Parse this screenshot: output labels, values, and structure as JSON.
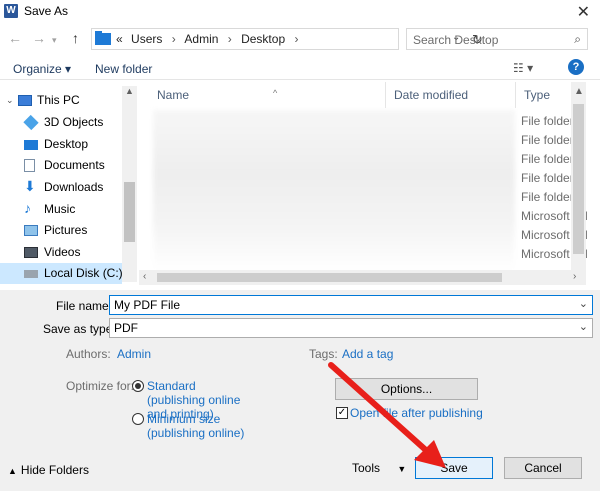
{
  "window": {
    "title": "Save As",
    "app_icon_letter": "W"
  },
  "address": {
    "crumbs": [
      "Users",
      "Admin",
      "Desktop"
    ],
    "overflow_glyph": "«",
    "search_placeholder": "Search Desktop"
  },
  "toolbar": {
    "organize_label": "Organize ▾",
    "new_folder_label": "New folder",
    "help_label": "?"
  },
  "nav": {
    "items": [
      {
        "label": "This PC",
        "icon": "this-pc-icon"
      },
      {
        "label": "3D Objects",
        "icon": "cube-icon"
      },
      {
        "label": "Desktop",
        "icon": "desktop-icon"
      },
      {
        "label": "Documents",
        "icon": "documents-icon"
      },
      {
        "label": "Downloads",
        "icon": "download-arrow-icon"
      },
      {
        "label": "Music",
        "icon": "music-note-icon"
      },
      {
        "label": "Pictures",
        "icon": "pictures-icon"
      },
      {
        "label": "Videos",
        "icon": "videos-icon"
      },
      {
        "label": "Local Disk (C:)",
        "icon": "drive-icon"
      }
    ]
  },
  "files": {
    "columns": [
      "Name",
      "Date modified",
      "Type"
    ],
    "types": [
      "File folder",
      "File folder",
      "File folder",
      "File folder",
      "File folder",
      "Microsoft Ed",
      "Microsoft Ed",
      "Microsoft Ed"
    ]
  },
  "form": {
    "file_name_label": "File name:",
    "file_name_value": "My PDF File",
    "save_as_type_label": "Save as type:",
    "save_as_type_value": "PDF",
    "authors_label": "Authors:",
    "authors_value": "Admin",
    "tags_label": "Tags:",
    "tags_value": "Add a tag",
    "optimize_label": "Optimize for:",
    "optimize_standard": "Standard (publishing online and printing)",
    "optimize_minimum": "Minimum size (publishing online)",
    "options_button": "Options...",
    "open_after_label": "Open file after publishing",
    "hide_folders_label": "Hide Folders",
    "tools_label": "Tools",
    "save_button": "Save",
    "cancel_button": "Cancel"
  },
  "colors": {
    "accent": "#0078d7",
    "link": "#1a6fc4",
    "annotation_arrow": "#e8201a"
  }
}
